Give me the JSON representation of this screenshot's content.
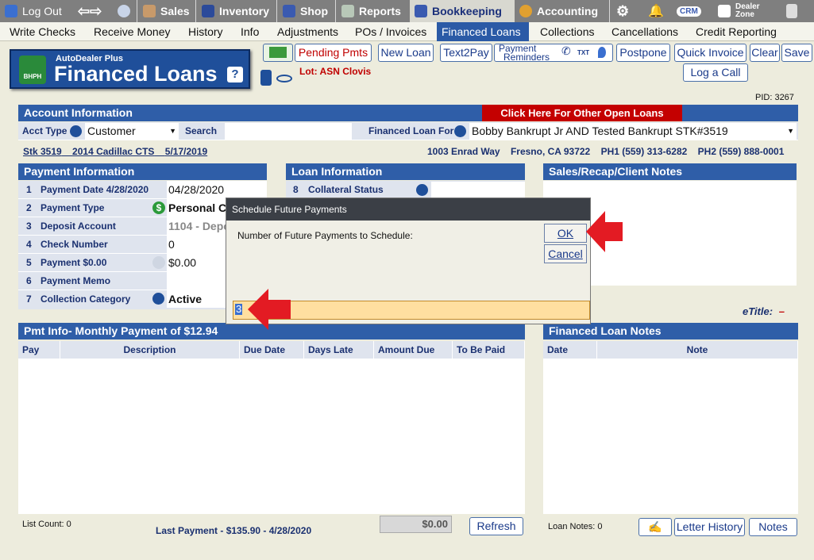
{
  "topnav": {
    "logout": "Log Out",
    "tabs": [
      "Sales",
      "Inventory",
      "Shop",
      "Reports",
      "Bookkeeping",
      "Accounting"
    ],
    "crm": "CRM",
    "dealer_zone": "Dealer Zone"
  },
  "subnav": [
    "Write Checks",
    "Receive Money",
    "History",
    "Info",
    "Adjustments",
    "POs / Invoices",
    "Financed Loans",
    "Collections",
    "Cancellations",
    "Credit Reporting"
  ],
  "logo": {
    "small": "AutoDealer Plus",
    "big": "Financed Loans",
    "badge": "BHPH",
    "help": "?"
  },
  "toolbar": {
    "pending": "Pending Pmts",
    "new_loan": "New Loan",
    "text2pay": "Text2Pay",
    "payment_reminders_1": "Payment",
    "payment_reminders_2": "Reminders",
    "txt": "TXT",
    "postpone": "Postpone",
    "quick_invoice": "Quick Invoice",
    "clear": "Clear",
    "save": "Save",
    "log_call": "Log a Call"
  },
  "lot": "Lot: ASN Clovis",
  "pid": "PID: 3267",
  "account": {
    "header": "Account Information",
    "other_loans": "Click Here For Other Open Loans",
    "acct_type_label": "Acct Type",
    "acct_type_value": "Customer",
    "search_label": "Search",
    "search_value": "",
    "financed_for_label": "Financed Loan For",
    "financed_for_value": "Bobby Bankrupt Jr AND Tested Bankrupt STK#3519",
    "stk": "Stk 3519",
    "vehicle": "2014 Cadillac CTS",
    "date": "5/17/2019",
    "address": "1003 Enrad Way",
    "city": "Fresno, CA 93722",
    "ph1": "PH1 (559) 313-6282",
    "ph2": "PH2 (559) 888-0001"
  },
  "payment": {
    "header": "Payment Information",
    "rows": [
      {
        "num": "1",
        "label": "Payment Date  4/28/2020",
        "value": "04/28/2020"
      },
      {
        "num": "2",
        "label": "Payment Type",
        "value": "Personal C"
      },
      {
        "num": "3",
        "label": "Deposit Account",
        "value": "1104 - Depo"
      },
      {
        "num": "4",
        "label": "Check Number",
        "value": "0"
      },
      {
        "num": "5",
        "label": "Payment  $0.00",
        "value": "$0.00"
      },
      {
        "num": "6",
        "label": "Payment Memo",
        "value": ""
      },
      {
        "num": "7",
        "label": "Collection Category",
        "value": "Active"
      }
    ]
  },
  "loan": {
    "header": "Loan Information",
    "row_num": "8",
    "row_label": "Collateral Status"
  },
  "notes_panel": {
    "header": "Sales/Recap/Client Notes"
  },
  "etitle": "eTitle:",
  "etitle_value": "–",
  "pmt_info": {
    "header": "Pmt Info- Monthly Payment of $12.94",
    "columns": [
      "Pay",
      "Description",
      "Due Date",
      "Days Late",
      "Amount Due",
      "To Be Paid"
    ],
    "list_count": "List Count:  0",
    "last_payment": "Last Payment - $135.90 - 4/28/2020",
    "total": "$0.00",
    "refresh": "Refresh"
  },
  "loan_notes": {
    "header": "Financed Loan Notes",
    "columns": [
      "Date",
      "Note"
    ],
    "count": "Loan Notes:  0",
    "letter_history": "Letter History",
    "notes": "Notes"
  },
  "dialog": {
    "title": "Schedule Future Payments",
    "prompt": "Number of Future Payments to Schedule:",
    "ok": "OK",
    "cancel": "Cancel",
    "value": "3"
  },
  "colors": {
    "nav_bg": "#7f7f7f",
    "header_blue": "#2f5ea8",
    "alert_red": "#e31b23"
  }
}
